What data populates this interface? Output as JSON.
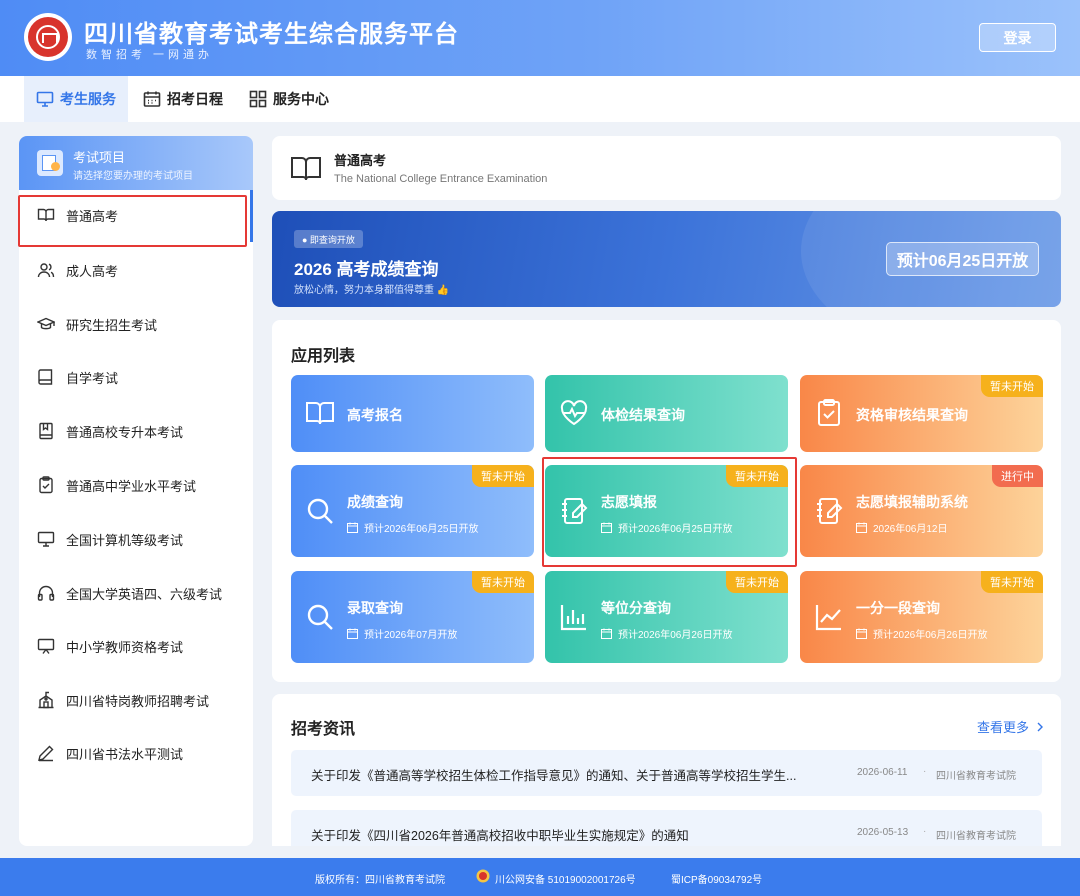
{
  "header": {
    "title": "四川省教育考试考生综合服务平台",
    "slogan": "数智招考 一网通办",
    "login_label": "登录"
  },
  "nav": {
    "items": [
      {
        "label": "考生服务",
        "icon": "monitor-icon",
        "active": true
      },
      {
        "label": "招考日程",
        "icon": "calendar-icon",
        "active": false
      },
      {
        "label": "服务中心",
        "icon": "grid-icon",
        "active": false
      }
    ]
  },
  "sidebar": {
    "header_title": "考试项目",
    "header_subtitle": "请选择您要办理的考试项目",
    "items": [
      {
        "label": "普通高考",
        "icon": "book-open-icon",
        "selected": true
      },
      {
        "label": "成人高考",
        "icon": "users-icon"
      },
      {
        "label": "研究生招生考试",
        "icon": "graduation-cap-icon"
      },
      {
        "label": "自学考试",
        "icon": "book-icon"
      },
      {
        "label": "普通高校专升本考试",
        "icon": "bookmark-book-icon"
      },
      {
        "label": "普通高中学业水平考试",
        "icon": "clipboard-check-icon"
      },
      {
        "label": "全国计算机等级考试",
        "icon": "monitor-icon"
      },
      {
        "label": "全国大学英语四、六级考试",
        "icon": "headphones-icon"
      },
      {
        "label": "中小学教师资格考试",
        "icon": "presentation-board-icon"
      },
      {
        "label": "四川省特岗教师招聘考试",
        "icon": "school-building-icon"
      },
      {
        "label": "四川省书法水平测试",
        "icon": "pen-icon"
      }
    ]
  },
  "exam_header": {
    "title": "普通高考",
    "subtitle": "The National College Entrance Examination"
  },
  "banner": {
    "badge": "● 即查询开放",
    "title": "2026 高考成绩查询",
    "subtitle": "放松心情，努力本身都值得尊重 👍",
    "open_label": "预计06月25日开放"
  },
  "apps": {
    "section_title": "应用列表",
    "items": [
      {
        "name": "高考报名",
        "icon": "book-open-icon",
        "color": "blue"
      },
      {
        "name": "体检结果查询",
        "icon": "heart-pulse-icon",
        "color": "green"
      },
      {
        "name": "资格审核结果查询",
        "icon": "clipboard-check-icon",
        "color": "orange",
        "tag": "暂未开始"
      },
      {
        "name": "成绩查询",
        "icon": "search-icon",
        "color": "blue",
        "tag": "暂未开始",
        "date": "预计2026年06月25日开放"
      },
      {
        "name": "志愿填报",
        "icon": "notebook-pen-icon",
        "color": "green",
        "tag": "暂未开始",
        "date": "预计2026年06月25日开放"
      },
      {
        "name": "志愿填报辅助系统",
        "icon": "notebook-pen-icon",
        "color": "orange",
        "tag": "进行中",
        "date": "2026年06月12日"
      },
      {
        "name": "录取查询",
        "icon": "search-icon",
        "color": "blue",
        "tag": "暂未开始",
        "date": "预计2026年07月开放"
      },
      {
        "name": "等位分查询",
        "icon": "bar-chart-icon",
        "color": "green",
        "tag": "暂未开始",
        "date": "预计2026年06月26日开放"
      },
      {
        "name": "一分一段查询",
        "icon": "line-chart-icon",
        "color": "orange",
        "tag": "暂未开始",
        "date": "预计2026年06月26日开放"
      }
    ]
  },
  "news": {
    "section_title": "招考资讯",
    "more_label": "查看更多",
    "items": [
      {
        "title": "关于印发《普通高等学校招生体检工作指导意见》的通知、关于普通高等学校招生学生...",
        "date": "2026-06-11",
        "source": "四川省教育考试院"
      },
      {
        "title": "关于印发《四川省2026年普通高校招收中职毕业生实施规定》的通知",
        "date": "2026-05-13",
        "source": "四川省教育考试院"
      }
    ]
  },
  "footer": {
    "copyright": "版权所有：四川省教育考试院",
    "police": "川公网安备 51019002001726号",
    "icp": "蜀ICP备09034792号"
  },
  "colors": {
    "primary": "#3476e8",
    "blue_card": "#4f8ef7",
    "green_card": "#33c3aa",
    "orange_card": "#f98748",
    "tag_yellow": "#f6b11c",
    "tag_red": "#f26c4f",
    "highlight_box": "#e53935"
  }
}
